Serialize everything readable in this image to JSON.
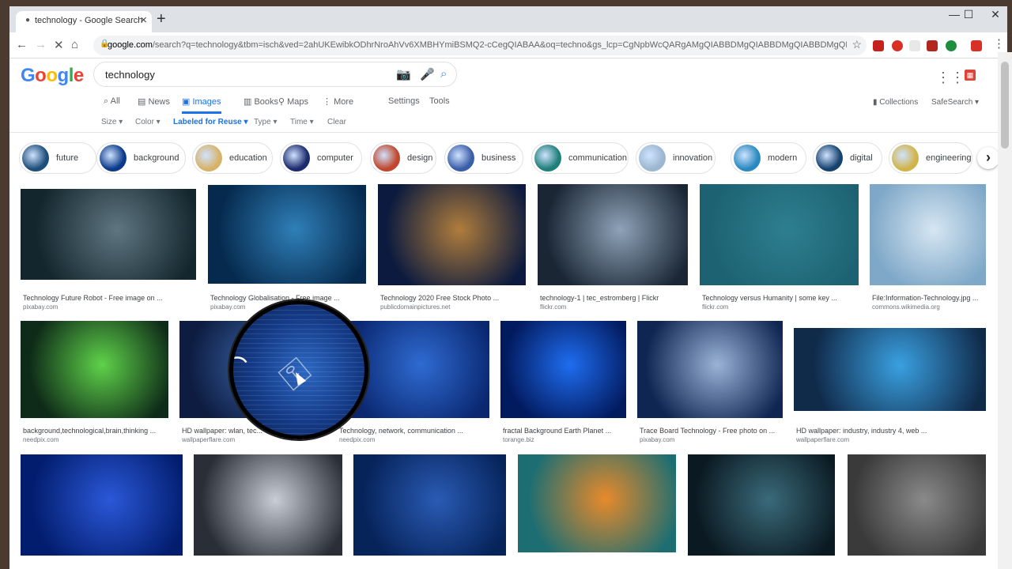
{
  "browser": {
    "tab_title": "technology - Google Search",
    "url_host": "google.com",
    "url_rest": "/search?q=technology&tbm=isch&ved=2ahUKEwibkODhrNroAhVv6XMBHYmiBSMQ2-cCegQIABAA&oq=techno&gs_lcp=CgNpbWcQARgAMgQIABBDMgQIABBDMgQIABBDMgQIABBDMgQIABB..."
  },
  "google": {
    "logo": [
      "G",
      "o",
      "o",
      "g",
      "l",
      "e"
    ],
    "logo_colors": [
      "#4285f4",
      "#ea4335",
      "#fbbc05",
      "#4285f4",
      "#34a853",
      "#ea4335"
    ],
    "query": "technology",
    "tabs": [
      {
        "label": "All",
        "icon": "search-icon",
        "active": false
      },
      {
        "label": "News",
        "icon": "news-icon",
        "active": false
      },
      {
        "label": "Images",
        "icon": "image-icon",
        "active": true
      },
      {
        "label": "Books",
        "icon": "book-icon",
        "active": false
      },
      {
        "label": "Maps",
        "icon": "map-pin-icon",
        "active": false
      },
      {
        "label": "More",
        "icon": "more-dots-icon",
        "active": false
      }
    ],
    "settings_label": "Settings",
    "tools_label": "Tools",
    "collections_label": "Collections",
    "safesearch_label": "SafeSearch",
    "filters": [
      "Size",
      "Color",
      "Labeled for Reuse",
      "Type",
      "Time"
    ],
    "clear_label": "Clear"
  },
  "chips": [
    {
      "label": "future",
      "color": "#1e4e7a"
    },
    {
      "label": "background",
      "color": "#0b3a8a"
    },
    {
      "label": "education",
      "color": "#d7b36a"
    },
    {
      "label": "computer",
      "color": "#1c2b6d"
    },
    {
      "label": "design",
      "color": "#c0472e"
    },
    {
      "label": "business",
      "color": "#3b5ea8"
    },
    {
      "label": "communication",
      "color": "#1f7f7a"
    },
    {
      "label": "innovation",
      "color": "#9db7d0"
    },
    {
      "label": "modern",
      "color": "#2a8ac0"
    },
    {
      "label": "digital",
      "color": "#16426e"
    },
    {
      "label": "engineering",
      "color": "#d0b44a"
    }
  ],
  "results": [
    {
      "title": "Technology Future Robot - Free image on ...",
      "source": "pixabay.com",
      "c1": "#13262e",
      "c2": "#5f7680"
    },
    {
      "title": "Technology Globalisation - Free image ...",
      "source": "pixabay.com",
      "c1": "#062a4e",
      "c2": "#2f7fb8"
    },
    {
      "title": "Technology 2020 Free Stock Photo ...",
      "source": "publicdomainpictures.net",
      "c1": "#0b1a3e",
      "c2": "#b07d3c"
    },
    {
      "title": "technology-1 | tec_estromberg | Flickr",
      "source": "flickr.com",
      "c1": "#1a2634",
      "c2": "#8ea2b8"
    },
    {
      "title": "Technology versus Humanity | some key ...",
      "source": "flickr.com",
      "c1": "#1d6272",
      "c2": "#2d7f90"
    },
    {
      "title": "File:Information-Technology.jpg ...",
      "source": "commons.wikimedia.org",
      "c1": "#7fa8c8",
      "c2": "#d6e6f2"
    },
    {
      "title": "background,technological,brain,thinking ...",
      "source": "needpix.com",
      "c1": "#0e2a18",
      "c2": "#5fd24a"
    },
    {
      "title": "HD wallpaper: wlan, tec...",
      "source": "wallpaperflare.com",
      "c1": "#0d1c40",
      "c2": "#3a63a8"
    },
    {
      "title": "Technology, network, communication ...",
      "source": "needpix.com",
      "c1": "#0a2770",
      "c2": "#2f6bd2"
    },
    {
      "title": "fractal Background Earth Planet ...",
      "source": "torange.biz",
      "c1": "#021a5e",
      "c2": "#1f6df0"
    },
    {
      "title": "Trace Board Technology - Free photo on ...",
      "source": "pixabay.com",
      "c1": "#0f2552",
      "c2": "#9ab3d6"
    },
    {
      "title": "HD wallpaper: industry, industry 4, web ...",
      "source": "wallpaperflare.com",
      "c1": "#102a4a",
      "c2": "#3aa0e0"
    },
    {
      "title": "",
      "source": "",
      "c1": "#021d6e",
      "c2": "#2b58d8"
    },
    {
      "title": "",
      "source": "",
      "c1": "#2a2e36",
      "c2": "#c9ced6"
    },
    {
      "title": "",
      "source": "",
      "c1": "#06235a",
      "c2": "#2a5bb4"
    },
    {
      "title": "",
      "source": "",
      "c1": "#1c6e72",
      "c2": "#e88a2a"
    },
    {
      "title": "",
      "source": "",
      "c1": "#0b1a22",
      "c2": "#3a6a7a"
    },
    {
      "title": "",
      "source": "",
      "c1": "#3a3a3a",
      "c2": "#8a8a8a"
    }
  ]
}
